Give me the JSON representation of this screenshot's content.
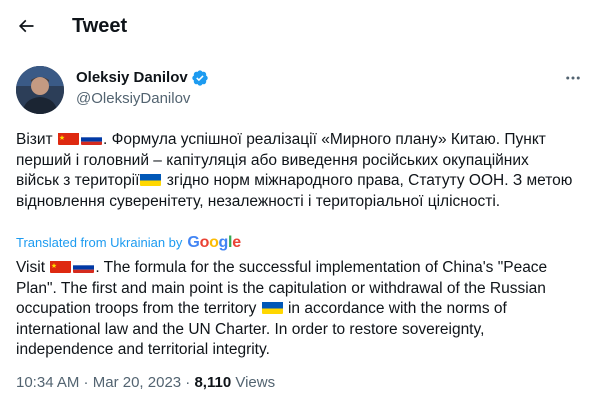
{
  "header": {
    "title": "Tweet",
    "back_icon": "arrow-left-icon"
  },
  "author": {
    "name": "Oleksiy Danilov",
    "handle": "@OleksiyDanilov",
    "verified": true
  },
  "tweet": {
    "uk_parts": [
      "Візит ",
      ". Формула успішної реалізації «Мирного плану» Китаю. Пункт перший і головний – капітуляція або виведення російських окупаційних військ з території",
      " згідно норм міжнародного права, Статуту ООН. З метою відновлення суверенітету, незалежності і територіальної цілісності."
    ],
    "translation_label": "Translated from Ukrainian by",
    "translation_provider": "Google",
    "en_parts": [
      "Visit ",
      ". The formula for the successful implementation of China's \"Peace Plan\". The first and main point is the capitulation or withdrawal of the Russian occupation troops from the territory ",
      " in accordance with the norms of international law and the UN Charter. In order to restore sovereignty, independence and territorial integrity."
    ]
  },
  "meta": {
    "time": "10:34 AM",
    "sep": " · ",
    "date": "Mar 20, 2023",
    "views_count": "8,110",
    "views_label": " Views"
  },
  "colors": {
    "link": "#1d9bf0",
    "muted": "#536471",
    "text": "#0f1419"
  }
}
